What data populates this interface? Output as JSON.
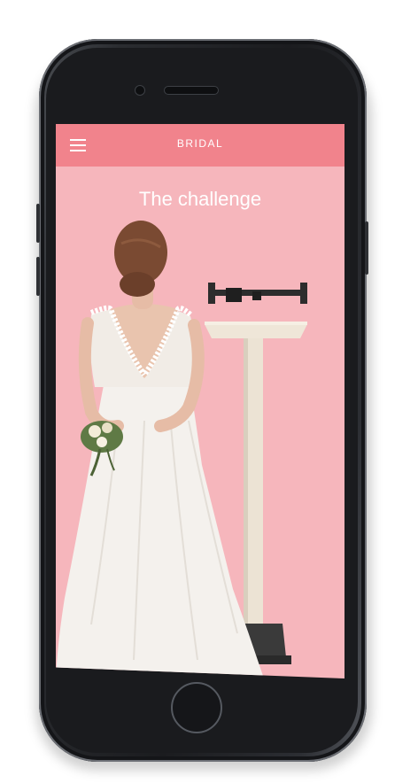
{
  "app": {
    "nav_title": "BRIDAL",
    "headline": "The challenge"
  },
  "icons": {
    "menu": "hamburger-menu-icon",
    "home": "home-button"
  },
  "colors": {
    "nav_background": "#f1838c",
    "screen_background": "#f6b6bc",
    "text": "#ffffff",
    "phone_body": "#1b1c1f"
  }
}
